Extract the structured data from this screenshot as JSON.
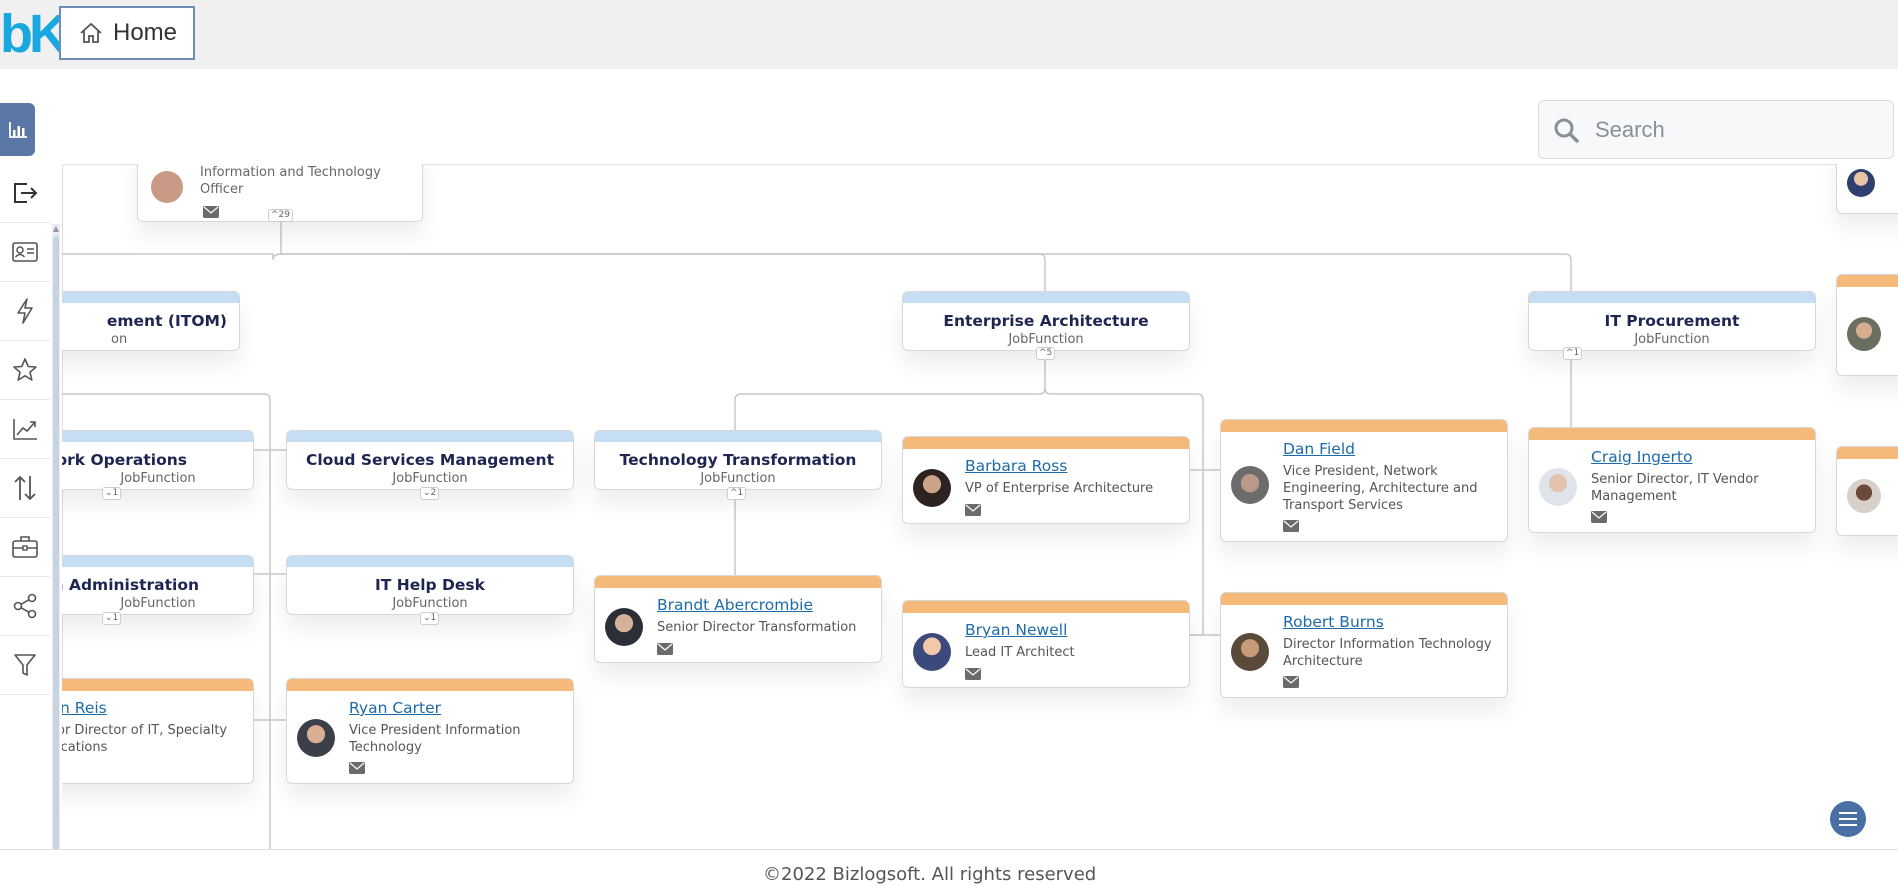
{
  "app": {
    "logo_text": "bK",
    "home_label": "Home"
  },
  "search": {
    "placeholder": "Search"
  },
  "sidebar": {
    "icons": [
      "logout-icon",
      "contact-card-icon",
      "lightning-icon",
      "star-icon",
      "trend-chart-icon",
      "sort-arrows-icon",
      "briefcase-icon",
      "share-icon",
      "filter-icon"
    ]
  },
  "chart": {
    "top_card": {
      "role": "Information and Technology Officer",
      "badge": "29"
    },
    "job_functions": [
      {
        "id": "itom",
        "title": "ement (ITOM)",
        "subtitle": "on"
      },
      {
        "id": "ea",
        "title": "Enterprise Architecture",
        "subtitle": "JobFunction",
        "badge": "5"
      },
      {
        "id": "procurement",
        "title": "IT Procurement",
        "subtitle": "JobFunction",
        "badge": "1"
      },
      {
        "id": "network-ops",
        "title": "work Operations",
        "subtitle": "JobFunction",
        "badge": "1"
      },
      {
        "id": "cloud",
        "title": "Cloud Services Management",
        "subtitle": "JobFunction",
        "badge": "2"
      },
      {
        "id": "transformation",
        "title": "Technology Transformation",
        "subtitle": "JobFunction",
        "badge": "1"
      },
      {
        "id": "sysadmin",
        "title": "em Administration",
        "subtitle": "JobFunction",
        "badge": "1"
      },
      {
        "id": "helpdesk",
        "title": "IT Help Desk",
        "subtitle": "JobFunction",
        "badge": "1"
      }
    ],
    "people": [
      {
        "id": "barbara",
        "name": "Barbara Ross",
        "role": "VP of Enterprise Architecture"
      },
      {
        "id": "dan",
        "name": "Dan Field",
        "role": "Vice President, Network Engineering, Architecture and Transport Services"
      },
      {
        "id": "craig",
        "name": "Craig Ingerto",
        "role": "Senior Director, IT Vendor Management"
      },
      {
        "id": "brandt",
        "name": "Brandt Abercrombie",
        "role": "Senior Director Transformation"
      },
      {
        "id": "bryan",
        "name": "Bryan Newell",
        "role": "Lead IT Architect"
      },
      {
        "id": "robert",
        "name": "Robert Burns",
        "role": "Director Information Technology Architecture"
      },
      {
        "id": "reis",
        "name": "n Reis",
        "role": "or Director of IT, Specialty ications"
      },
      {
        "id": "ryan",
        "name": "Ryan Carter",
        "role": "Vice President Information Technology"
      }
    ]
  },
  "footer": {
    "text": "©2022 Bizlogsoft. All rights reserved"
  },
  "colors": {
    "accent": "#5a77a6",
    "job_header": "#c6def3",
    "person_header": "#f5b97a",
    "link": "#1d6ba8",
    "logo": "#19a7e0"
  }
}
